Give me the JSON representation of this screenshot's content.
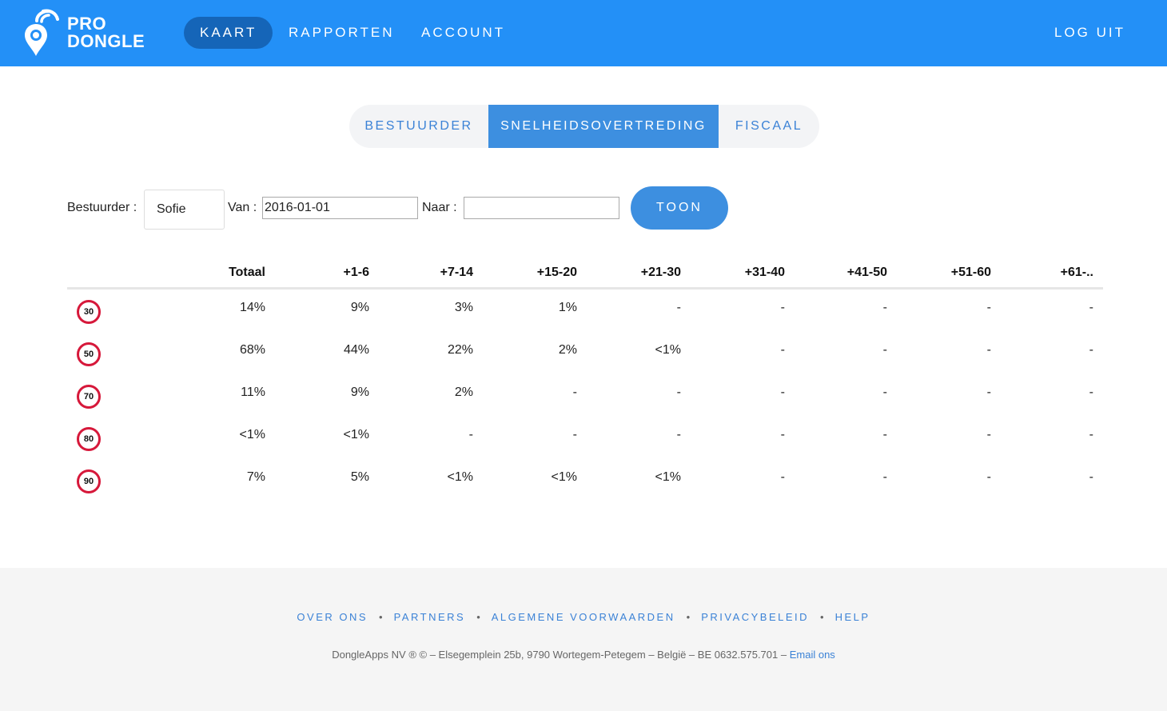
{
  "header": {
    "logo": {
      "line1": "PRO",
      "line2": "DONGLE"
    },
    "nav": [
      {
        "label": "KAART",
        "active": true
      },
      {
        "label": "RAPPORTEN",
        "active": false
      },
      {
        "label": "ACCOUNT",
        "active": false
      }
    ],
    "logout_label": "LOG UIT"
  },
  "tabs": [
    {
      "label": "BESTUURDER",
      "active": false
    },
    {
      "label": "SNELHEIDSOVERTREDING",
      "active": true
    },
    {
      "label": "FISCAAL",
      "active": false
    }
  ],
  "filters": {
    "driver_label": "Bestuurder :",
    "driver_value": "Sofie",
    "from_label": "Van :",
    "from_value": "2016-01-01",
    "to_label": "Naar :",
    "to_value": "",
    "submit_label": "TOON"
  },
  "table": {
    "columns": [
      "Totaal",
      "+1-6",
      "+7-14",
      "+15-20",
      "+21-30",
      "+31-40",
      "+41-50",
      "+51-60",
      "+61-.."
    ],
    "rows": [
      {
        "limit": "30",
        "cells": [
          "14%",
          "9%",
          "3%",
          "1%",
          "-",
          "-",
          "-",
          "-",
          "-"
        ]
      },
      {
        "limit": "50",
        "cells": [
          "68%",
          "44%",
          "22%",
          "2%",
          "<1%",
          "-",
          "-",
          "-",
          "-"
        ]
      },
      {
        "limit": "70",
        "cells": [
          "11%",
          "9%",
          "2%",
          "-",
          "-",
          "-",
          "-",
          "-",
          "-"
        ]
      },
      {
        "limit": "80",
        "cells": [
          "<1%",
          "<1%",
          "-",
          "-",
          "-",
          "-",
          "-",
          "-",
          "-"
        ]
      },
      {
        "limit": "90",
        "cells": [
          "7%",
          "5%",
          "<1%",
          "<1%",
          "<1%",
          "-",
          "-",
          "-",
          "-"
        ]
      }
    ]
  },
  "footer": {
    "links": [
      "OVER ONS",
      "PARTNERS",
      "ALGEMENE VOORWAARDEN",
      "PRIVACYBELEID",
      "HELP"
    ],
    "separator": "•",
    "copyright": "DongleApps NV ® © – Elsegemplein 25b, 9790 Wortegem-Petegem – België – BE 0632.575.701 –",
    "email_link": "Email ons"
  },
  "colors": {
    "header_bg": "#2390f7",
    "accent": "#3d8fe0",
    "active_nav": "#1565b8",
    "sign_border": "#d6183a"
  }
}
